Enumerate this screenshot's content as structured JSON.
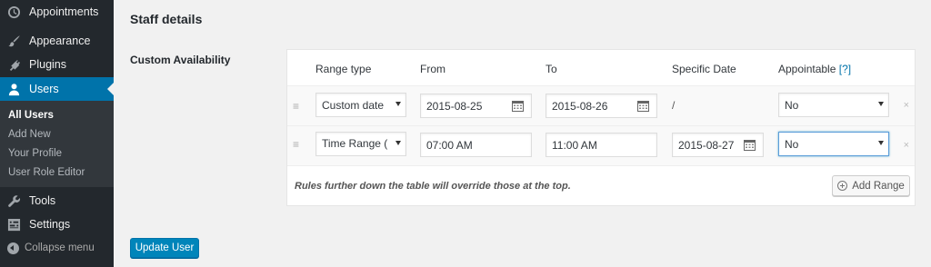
{
  "sidebar": {
    "menu": [
      {
        "label": "Appointments",
        "icon": "clock-icon"
      },
      {
        "label": "Appearance",
        "icon": "paintbrush-icon"
      },
      {
        "label": "Plugins",
        "icon": "plugin-icon"
      },
      {
        "label": "Users",
        "icon": "users-icon",
        "active": true
      },
      {
        "label": "Tools",
        "icon": "wrench-icon"
      },
      {
        "label": "Settings",
        "icon": "settings-icon"
      }
    ],
    "submenu": [
      {
        "label": "All Users",
        "current": true
      },
      {
        "label": "Add New"
      },
      {
        "label": "Your Profile"
      },
      {
        "label": "User Role Editor"
      }
    ],
    "collapse_label": "Collapse menu"
  },
  "main": {
    "section_title": "Staff details",
    "field_label": "Custom Availability",
    "table": {
      "headers": {
        "range_type": "Range type",
        "from": "From",
        "to": "To",
        "specific_date": "Specific Date",
        "appointable": "Appointable",
        "appointable_help": "[?]"
      },
      "rows": [
        {
          "range_type": "Custom date",
          "from": "2015-08-25",
          "to": "2015-08-26",
          "specific_date": "/",
          "appointable": "No"
        },
        {
          "range_type": "Time Range (",
          "from": "07:00  AM",
          "to": "11:00  AM",
          "specific_date": "2015-08-27",
          "appointable": "No"
        }
      ],
      "handle_glyph": "≡",
      "remove_glyph": "×"
    },
    "footnote": "Rules further down the table will override those at the top.",
    "add_range_label": "Add Range",
    "update_button_label": "Update User"
  },
  "colors": {
    "sidebar_bg": "#23282d",
    "submenu_bg": "#32373c",
    "active_blue": "#0073aa",
    "primary_button": "#0085ba"
  }
}
